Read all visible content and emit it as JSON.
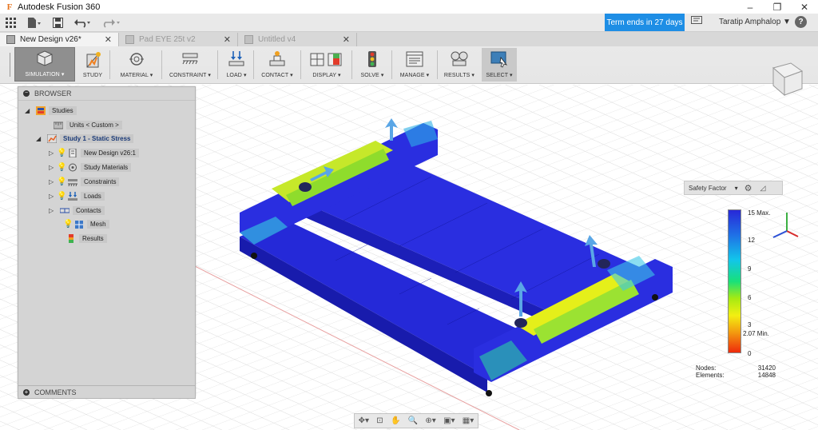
{
  "window": {
    "title": "Autodesk Fusion 360",
    "minimize": "–",
    "restore": "❐",
    "close": "✕"
  },
  "qat": {
    "trial_label": "Term ends in 27 days",
    "user_name": "Taratip Amphalop ▼",
    "help": "?"
  },
  "tabs": [
    {
      "label": "New Design v26*",
      "active": true
    },
    {
      "label": "Pad EYE 25t v2",
      "active": false
    },
    {
      "label": "Untitled v4",
      "active": false
    }
  ],
  "toolbar": {
    "workspace": "SIMULATION ▾",
    "study": "STUDY",
    "material": "MATERIAL ▾",
    "constraint": "CONSTRAINT ▾",
    "load": "LOAD ▾",
    "contact": "CONTACT ▾",
    "display": "DISPLAY ▾",
    "solve": "SOLVE ▾",
    "manage": "MANAGE ▾",
    "results": "RESULTS ▾",
    "select": "SELECT ▾"
  },
  "browser": {
    "header": "BROWSER",
    "studies": "Studies",
    "units": "Units < Custom >",
    "study": "Study 1 - Static Stress",
    "items": [
      {
        "label": "New Design v26:1",
        "icon": "component-icon"
      },
      {
        "label": "Study Materials",
        "icon": "materials-icon"
      },
      {
        "label": "Constraints",
        "icon": "constraints-icon"
      },
      {
        "label": "Loads",
        "icon": "loads-icon"
      },
      {
        "label": "Contacts",
        "icon": "contacts-icon"
      },
      {
        "label": "Mesh",
        "icon": "mesh-icon"
      },
      {
        "label": "Results",
        "icon": "results-icon"
      }
    ],
    "comments": "COMMENTS"
  },
  "legend": {
    "title": "Safety Factor",
    "caret": "▾",
    "ticks": [
      "15 Max.",
      "12",
      "9",
      "6",
      "3",
      "2.07 Min.",
      "0"
    ],
    "nodes_label": "Nodes:",
    "nodes_value": "31420",
    "elements_label": "Elements:",
    "elements_value": "14848"
  },
  "colors": {
    "trial_bg": "#1e8ee5",
    "study_text": "#1a3a78",
    "mesh_blue": "#1a1ad0",
    "stress_high": "#e3ef12"
  }
}
